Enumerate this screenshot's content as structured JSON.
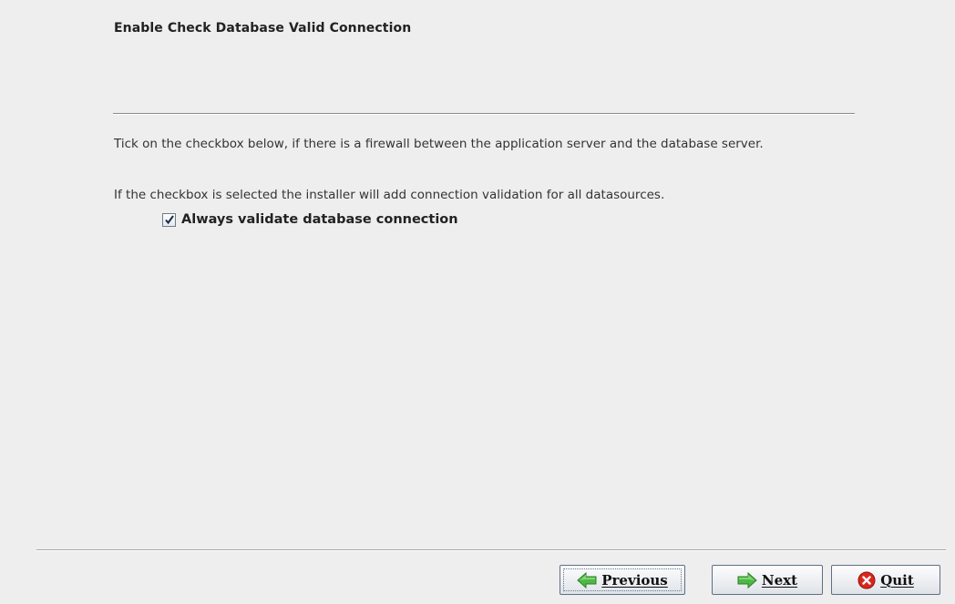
{
  "header": {
    "title": "Enable Check Database Valid Connection"
  },
  "content": {
    "paragraph1": "Tick on the checkbox below, if there is a firewall between the application server and the database server.",
    "paragraph2": "If the checkbox is selected the installer will add connection validation for all datasources.",
    "checkbox": {
      "label": "Always validate database connection",
      "checked": true
    }
  },
  "footer": {
    "previous_label": "Previous",
    "next_label": "Next",
    "quit_label": "Quit",
    "previous_icon": "arrow-left-icon",
    "next_icon": "arrow-right-icon",
    "quit_icon": "close-circle-icon"
  },
  "colors": {
    "arrow_green": "#3fa535",
    "quit_red": "#d9261c",
    "button_border": "#5f6f86"
  }
}
